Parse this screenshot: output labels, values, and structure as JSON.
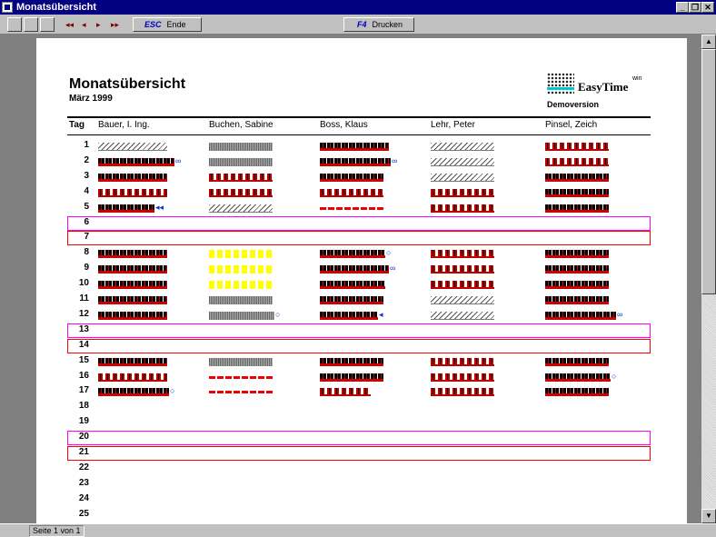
{
  "window": {
    "title": "Monatsübersicht",
    "minimize": "_",
    "restore": "❐",
    "close": "✕"
  },
  "toolbar": {
    "nav": [
      "◂◂",
      "◂",
      "▸",
      "▸▸"
    ],
    "esc_key": "ESC",
    "esc_label": "Ende",
    "print_key": "F4",
    "print_label": "Drucken"
  },
  "report": {
    "title": "Monatsübersicht",
    "subtitle": "März 1999",
    "logo": {
      "brand": "EasyTime",
      "sup": "win",
      "demo": "Demoversion"
    },
    "header": {
      "tag": "Tag",
      "employees": [
        "Bauer, I. Ing.",
        "Buchen, Sabine",
        "Boss, Klaus",
        "Lehr, Peter",
        "Pinsel, Zeich"
      ]
    },
    "days": [
      "1",
      "2",
      "3",
      "4",
      "5",
      "6",
      "7",
      "8",
      "9",
      "10",
      "11",
      "12",
      "13",
      "14",
      "15",
      "16",
      "17",
      "18",
      "19",
      "20",
      "21",
      "22",
      "23",
      "24",
      "25"
    ],
    "weekend_days": [
      6,
      7,
      13,
      14,
      20,
      21
    ],
    "colors": {
      "saturday": "#ff00ff",
      "sunday": "#ff0000",
      "red_pattern": "#bb0000",
      "yellow": "#ffff00",
      "marker": "#1030d0"
    }
  },
  "status": {
    "page": "Seite 1 von 1"
  }
}
